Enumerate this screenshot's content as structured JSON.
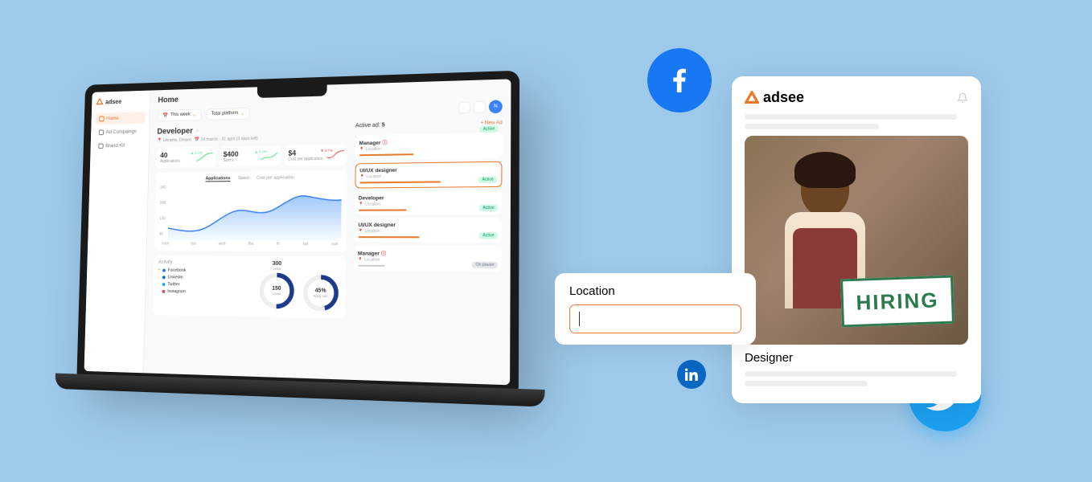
{
  "brand": "adsee",
  "sidebar": {
    "items": [
      {
        "label": "Home"
      },
      {
        "label": "Ad Compaings"
      },
      {
        "label": "Brand Kit"
      }
    ]
  },
  "page": {
    "title": "Home"
  },
  "filters": {
    "period": "This week",
    "platform": "Total platform"
  },
  "avatar": "N",
  "campaign": {
    "title": "Developer",
    "location": "Ukraine, Dnipro",
    "dates": "24 march - 31 april (3 days left)",
    "status": "Active"
  },
  "stats": [
    {
      "value": "40",
      "label": "Applications",
      "delta": "▲ 2.1%"
    },
    {
      "value": "$400",
      "label": "Spent",
      "delta": "▲ 2.1%"
    },
    {
      "value": "$4",
      "label": "Cost per application",
      "delta": "▼ 0.7%"
    }
  ],
  "chart": {
    "tabs": [
      "Applications",
      "Spent",
      "Cost per application"
    ],
    "active": 0,
    "y_ticks": [
      "340",
      "240",
      "140",
      "40"
    ],
    "x_days": [
      "mon",
      "tue",
      "wed",
      "thu",
      "fri",
      "sat",
      "sun"
    ]
  },
  "activity": {
    "title": "Activity",
    "sources": [
      "Facebook",
      "Linkedin",
      "Twitter",
      "Instagram"
    ],
    "donuts": [
      {
        "top": "300",
        "toplbl": "Views",
        "value": "150",
        "label": "Clicks"
      },
      {
        "value": "45%",
        "label": "Apply rate"
      }
    ]
  },
  "active_ads": {
    "title": "Active ad:",
    "count": "5",
    "new": "+ New Ad",
    "items": [
      {
        "title": "Manager",
        "warn": true,
        "status": "Active"
      },
      {
        "title": "UI/UX designer",
        "status": "Active",
        "selected": true
      },
      {
        "title": "Developer",
        "status": "Active"
      },
      {
        "title": "UI/UX designer",
        "status": "Active"
      },
      {
        "title": "Manager",
        "warn": true,
        "status": "On pause"
      }
    ],
    "loc_label": "Location"
  },
  "location_input": {
    "label": "Location",
    "value": ""
  },
  "ad_preview": {
    "role": "Designer",
    "sign": "HIRING"
  },
  "chart_data": {
    "type": "area",
    "x": [
      "mon",
      "tue",
      "wed",
      "thu",
      "fri",
      "sat",
      "sun"
    ],
    "values": [
      80,
      60,
      140,
      200,
      160,
      300,
      260
    ],
    "ylim": [
      40,
      340
    ],
    "ylabel": "Applications"
  }
}
